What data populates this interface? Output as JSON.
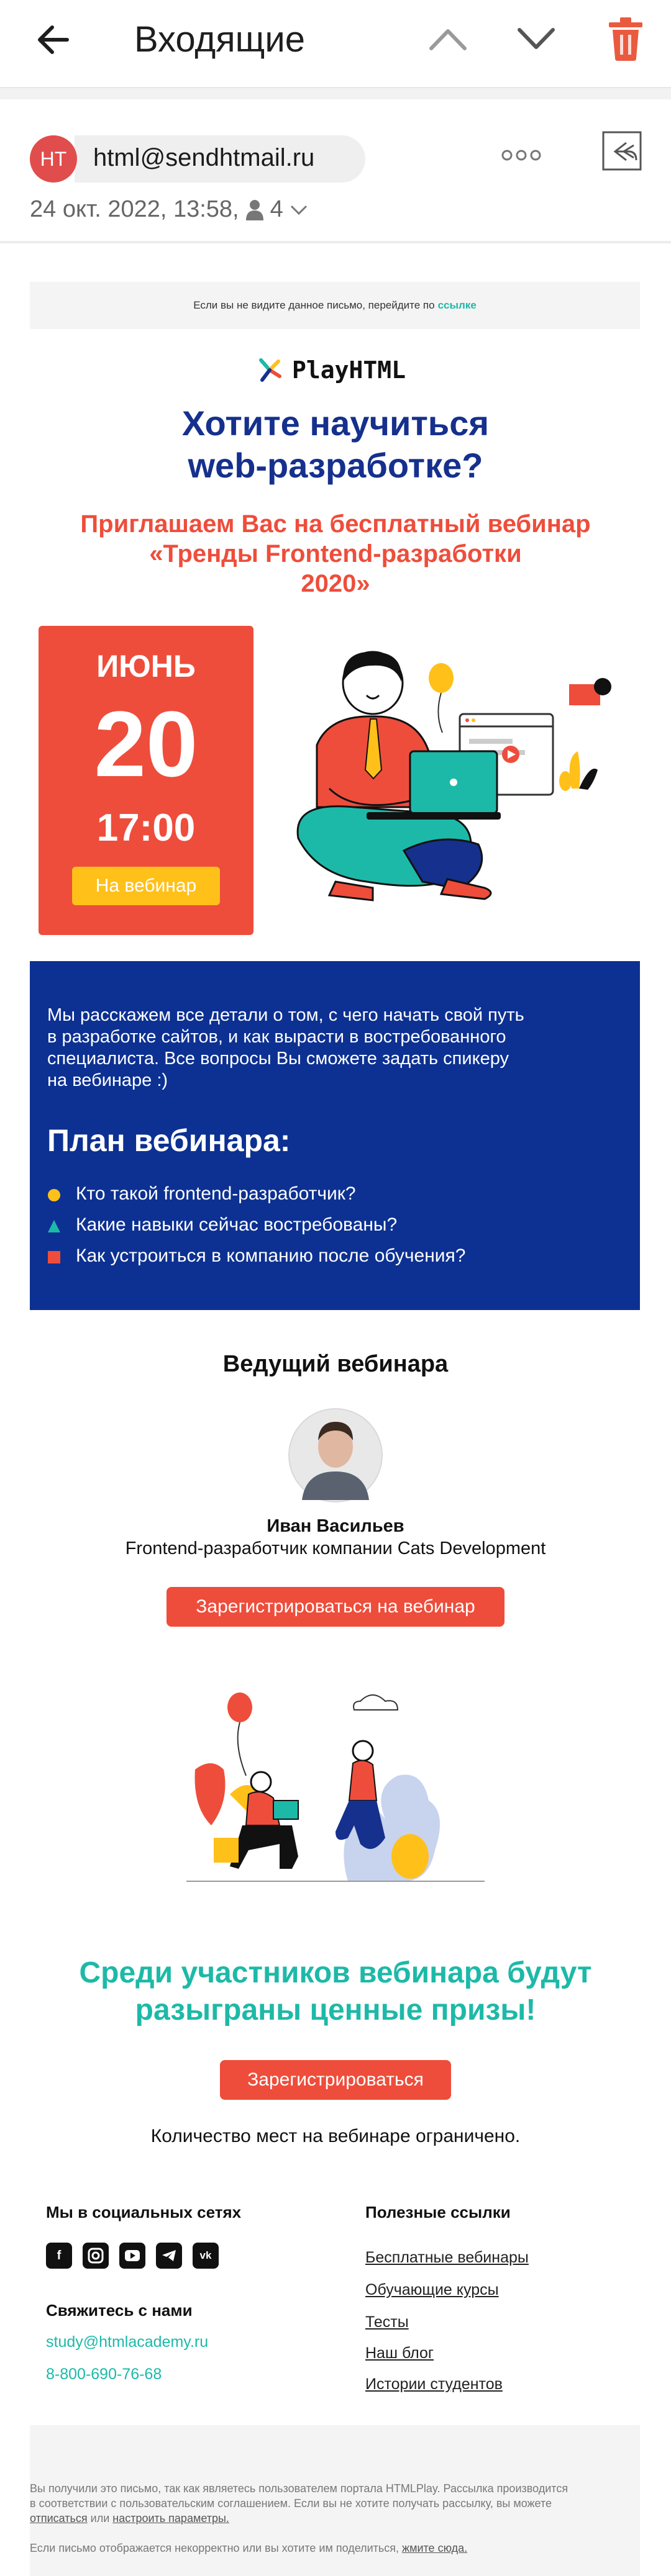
{
  "appbar": {
    "title": "Входящие"
  },
  "message": {
    "avatar_initials": "HT",
    "sender_email": "html@sendhtmail.ru",
    "date": "24 окт. 2022, 13:58,",
    "recipients_count": "4"
  },
  "email": {
    "preheader_text": "Если вы не видите данное письмо, перейдите по",
    "preheader_link": "ссылке",
    "logo_text": "PlayHTML",
    "headline_line1": "Хотите научиться",
    "headline_line2": "web-разработке?",
    "subhead_line1": "Приглашаем Вас на бесплатный вебинар",
    "subhead_line2": "«Тренды Frontend-разработки",
    "subhead_line3": "2020»",
    "event": {
      "month": "ИЮНЬ",
      "day": "20",
      "time": "17:00",
      "button": "На вебинар"
    },
    "intro_lines": [
      "Мы расскажем все детали о том, с чего начать свой путь",
      "в разработке сайтов, и как вырасти в востребованного",
      "специалиста. Все вопросы Вы сможете задать спикеру",
      "на вебинаре :)"
    ],
    "plan_title": "План вебинара:",
    "plan_items": [
      "Кто такой frontend-разработчик?",
      "Какие навыки сейчас востребованы?",
      "Как устроиться в компанию после обучения?"
    ],
    "host_heading": "Ведущий вебинара",
    "host_name": "Иван Васильев",
    "host_role": "Frontend-разработчик компании Cats Development",
    "register_webinar_button": "Зарегистрироваться на вебинар",
    "prizes_line1": "Среди участников вебинара будут",
    "prizes_line2": "разыграны ценные призы!",
    "register_button": "Зарегистрироваться",
    "limited_text": "Количество мест на вебинаре ограничено."
  },
  "footer": {
    "social_heading": "Мы в социальных сетях",
    "social_icons": [
      "facebook-icon",
      "instagram-icon",
      "youtube-icon",
      "telegram-icon",
      "vk-icon"
    ],
    "contact_heading": "Свяжитесь с нами",
    "contact_email": "study@htmlacademy.ru",
    "contact_phone": "8-800-690-76-68",
    "links_heading": "Полезные ссылки",
    "links": [
      "Бесплатные вебинары",
      "Обучающие курсы",
      "Тесты",
      "Наш блог",
      "Истории студентов"
    ],
    "fine_line1": "Вы получили это письмо, так как являетесь пользователем портала HTMLPlay. Рассылка производится",
    "fine_line2": "в соответствии с пользовательским соглашением. Если вы не хотите получать рассылку, вы можете",
    "fine_unsub": "отписаться",
    "fine_or": " или ",
    "fine_settings": "настроить параметры.",
    "fine_line4": "Если письмо отображается некорректно или вы хотите им поделиться, ",
    "fine_here": "жмите сюда."
  },
  "colors": {
    "brand_blue": "#15308d",
    "panel_blue": "#0d3192",
    "accent_red": "#ee4d3b",
    "accent_yellow": "#ffc01a",
    "accent_teal": "#1db9a8"
  }
}
